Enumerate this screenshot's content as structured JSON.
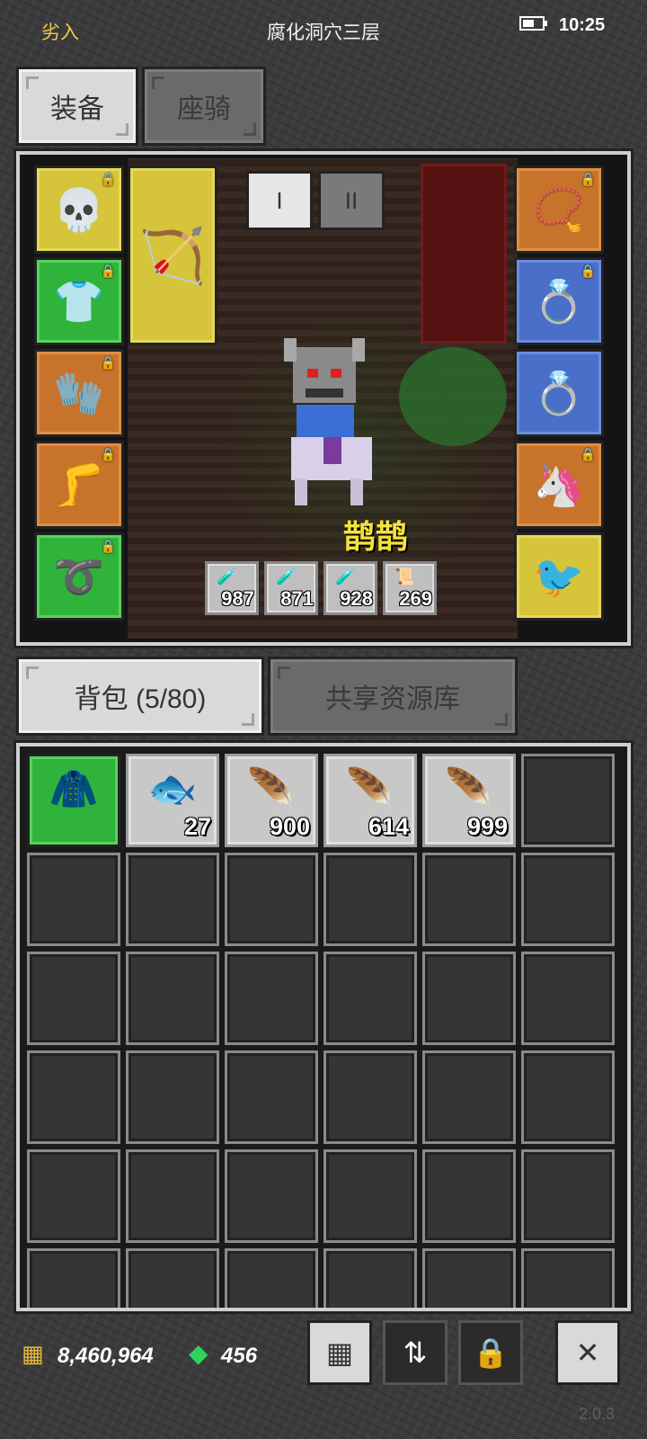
{
  "status_bar": {
    "left_text": "劣入",
    "title": "腐化洞穴三层",
    "time": "10:25",
    "battery_level": 0.6
  },
  "top_tabs": [
    {
      "label": "装备",
      "active": true
    },
    {
      "label": "座骑",
      "active": false
    }
  ],
  "equipment": {
    "left_slots": [
      {
        "icon": "skull-helmet-icon",
        "glyph": "💀",
        "color": "yellow",
        "locked": true
      },
      {
        "icon": "chainmail-armor-icon",
        "glyph": "👕",
        "color": "green",
        "locked": true
      },
      {
        "icon": "gauntlets-icon",
        "glyph": "🧤",
        "color": "orange",
        "locked": true
      },
      {
        "icon": "greaves-icon",
        "glyph": "🦵",
        "color": "orange",
        "locked": true
      },
      {
        "icon": "belt-icon",
        "glyph": "➰",
        "color": "green",
        "locked": true
      }
    ],
    "weapon_slot": {
      "icon": "bow-icon",
      "glyph": "🏹",
      "color": "yellow"
    },
    "right_slots": [
      {
        "icon": "ruby-amulet-icon",
        "glyph": "📿",
        "color": "orange",
        "locked": true
      },
      {
        "icon": "gold-ring-icon",
        "glyph": "💍",
        "color": "blue",
        "locked": true
      },
      {
        "icon": "ring-icon",
        "glyph": "💍",
        "color": "blue",
        "locked": false
      },
      {
        "icon": "unicorn-mount-icon",
        "glyph": "🦄",
        "color": "orange",
        "locked": true
      },
      {
        "icon": "magpie-pet-icon",
        "glyph": "🐦",
        "color": "yellow",
        "locked": false
      }
    ],
    "preset_tabs": [
      "I",
      "II"
    ],
    "character_name": "鹊鹊",
    "potions": [
      {
        "icon": "red-potion-icon",
        "glyph": "🧪",
        "value": "987"
      },
      {
        "icon": "blue-potion-icon",
        "glyph": "🧪",
        "value": "871"
      },
      {
        "icon": "mana-potion-icon",
        "glyph": "🧪",
        "value": "928"
      },
      {
        "icon": "scroll-potion-icon",
        "glyph": "📜",
        "value": "269"
      }
    ]
  },
  "bag_tabs": [
    {
      "label": "背包 (5/80)",
      "active": true
    },
    {
      "label": "共享资源库",
      "active": false
    }
  ],
  "bag_items": [
    {
      "icon": "leather-armor-icon",
      "glyph": "🧥",
      "qty": "",
      "style": "green"
    },
    {
      "icon": "fish-icon",
      "glyph": "🐟",
      "qty": "27",
      "style": "filled"
    },
    {
      "icon": "blue-feather-icon",
      "glyph": "🪶",
      "qty": "900",
      "style": "filled"
    },
    {
      "icon": "red-feather-icon",
      "glyph": "🪶",
      "qty": "614",
      "style": "filled"
    },
    {
      "icon": "red-feather-icon",
      "glyph": "🪶",
      "qty": "999",
      "style": "filled"
    }
  ],
  "currency": {
    "gold": "8,460,964",
    "gems": "456"
  },
  "bottom_buttons": [
    {
      "icon": "grid-icon",
      "glyph": "▦"
    },
    {
      "icon": "sort-icon",
      "glyph": "⇅"
    },
    {
      "icon": "lock-icon",
      "glyph": "🔒"
    },
    {
      "icon": "close-icon",
      "glyph": "✕"
    }
  ],
  "version": "2.0.3"
}
